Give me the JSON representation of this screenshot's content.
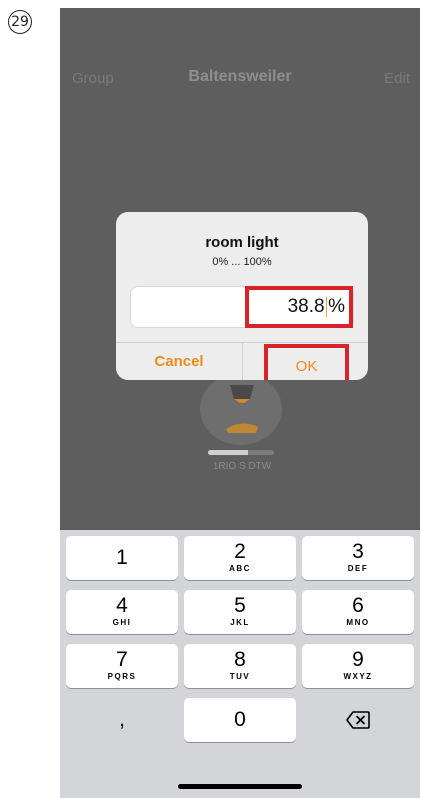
{
  "step": {
    "number": "29"
  },
  "nav": {
    "left": "Group",
    "title": "Baltensweiler",
    "right": "Edit"
  },
  "device": {
    "label": "1RIO S DTW",
    "level_fraction": 0.6
  },
  "dialog": {
    "title": "room light",
    "range": "0% ... 100%",
    "value": "38.8",
    "unit": "%",
    "cancel": "Cancel",
    "ok": "OK"
  },
  "keyboard": {
    "keys": [
      {
        "num": "1",
        "letters": ""
      },
      {
        "num": "2",
        "letters": "ABC"
      },
      {
        "num": "3",
        "letters": "DEF"
      },
      {
        "num": "4",
        "letters": "GHI"
      },
      {
        "num": "5",
        "letters": "JKL"
      },
      {
        "num": "6",
        "letters": "MNO"
      },
      {
        "num": "7",
        "letters": "PQRS"
      },
      {
        "num": "8",
        "letters": "TUV"
      },
      {
        "num": "9",
        "letters": "WXYZ"
      },
      {
        "num": "0",
        "letters": ""
      }
    ],
    "decimal": ",",
    "delete_icon": "backspace-icon"
  },
  "colors": {
    "accent": "#ef8b1e",
    "highlight": "#d8232a",
    "overlay": "#5e5e5e"
  }
}
